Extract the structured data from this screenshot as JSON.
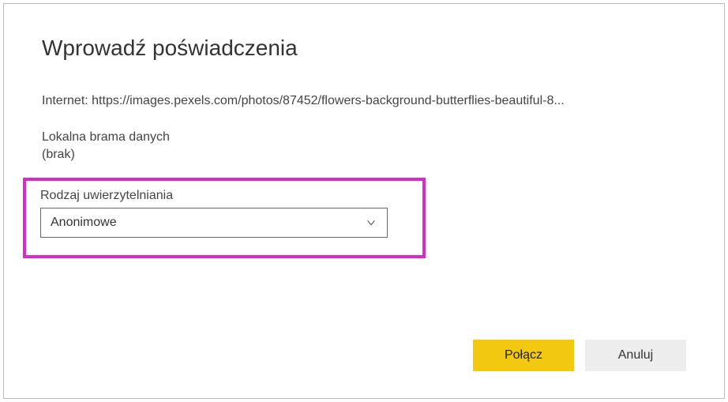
{
  "dialog": {
    "title": "Wprowadź poświadczenia",
    "url_label": "Internet: https://images.pexels.com/photos/87452/flowers-background-butterflies-beautiful-8...",
    "gateway_label": "Lokalna brama danych",
    "gateway_value": "(brak)",
    "auth_label": "Rodzaj uwierzytelniania",
    "auth_selected": "Anonimowe",
    "connect_label": "Połącz",
    "cancel_label": "Anuluj"
  }
}
